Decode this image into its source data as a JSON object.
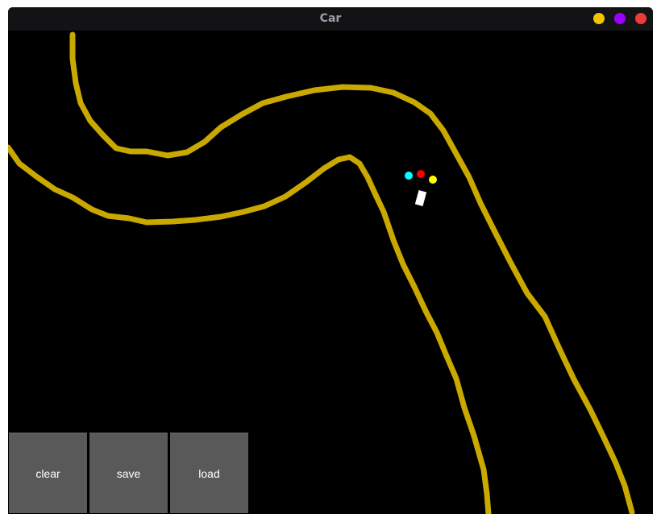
{
  "window": {
    "title": "Car",
    "controls": [
      {
        "name": "minimize-button",
        "color": "#f2c500"
      },
      {
        "name": "maximize-button",
        "color": "#9b00ff"
      },
      {
        "name": "close-button",
        "color": "#f03a3a"
      }
    ]
  },
  "colors": {
    "background": "#000000",
    "track": "#c9a800",
    "car": "#ffffff",
    "sensor_left": "#00ffff",
    "sensor_center": "#ff0000",
    "sensor_right": "#ffff00",
    "button_bg": "#595959",
    "button_text": "#ffffff"
  },
  "toolbar": {
    "clear_label": "clear",
    "save_label": "save",
    "load_label": "load"
  }
}
